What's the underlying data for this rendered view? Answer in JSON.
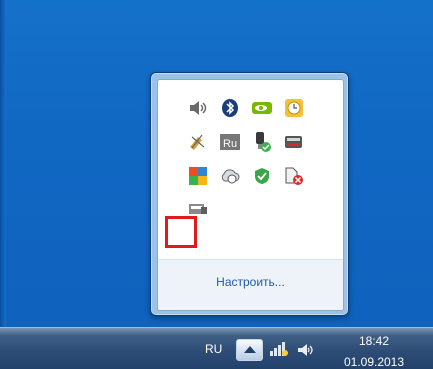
{
  "tray_overflow": {
    "icons": [
      "speaker-icon",
      "bluetooth-icon",
      "nvidia-icon",
      "clock-app-icon",
      "satellite-icon",
      "ru-keyboard-icon",
      "usb-device-icon",
      "battery-monitor-icon",
      "avg-antivirus-icon",
      "cloud-sync-icon",
      "shield-app-icon",
      "network-error-icon",
      "display-utility-icon"
    ],
    "keyboard_badge": "Ru",
    "customize_label": "Настроить...",
    "highlight_color": "#e11b1b"
  },
  "taskbar": {
    "language": "RU",
    "clock": {
      "time": "18:42",
      "date": "01.09.2013"
    }
  }
}
